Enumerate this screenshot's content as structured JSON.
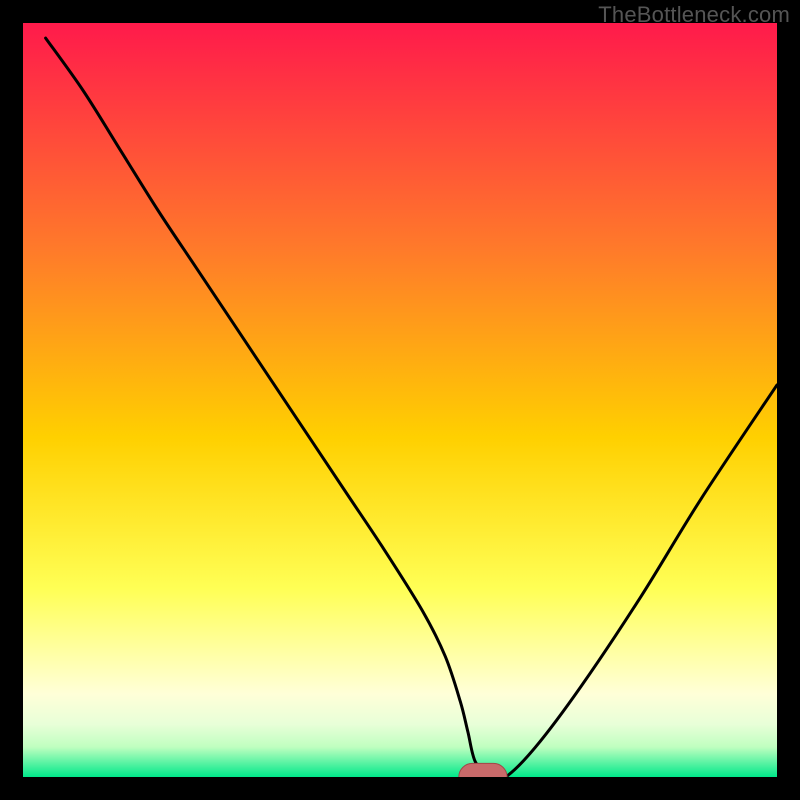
{
  "watermark": "TheBottleneck.com",
  "colors": {
    "frame": "#000000",
    "top": "#ff1a4b",
    "mid1": "#ff7a2a",
    "mid2": "#ffd000",
    "mid3": "#ffff55",
    "pale1": "#ffffd8",
    "pale2": "#e8ffd8",
    "pale3": "#c0ffc0",
    "bottom": "#00e88a",
    "curve": "#000000",
    "marker_fill": "#c86a6a",
    "marker_stroke": "#a04848"
  },
  "chart_data": {
    "type": "line",
    "title": "",
    "xlabel": "",
    "ylabel": "",
    "xlim": [
      0,
      100
    ],
    "ylim": [
      0,
      100
    ],
    "x": [
      3,
      8,
      13,
      18,
      23,
      28,
      33,
      38,
      43,
      48,
      53,
      56,
      58,
      59,
      60,
      62,
      64,
      68,
      74,
      82,
      90,
      100
    ],
    "values": [
      98,
      91,
      83,
      75,
      67.5,
      60,
      52.5,
      45,
      37.5,
      30,
      22,
      16,
      10,
      6,
      2,
      0,
      0,
      4,
      12,
      24,
      37,
      52
    ],
    "marker": {
      "x": 61,
      "y": 0,
      "rx": 3.2,
      "ry": 1.8
    }
  }
}
